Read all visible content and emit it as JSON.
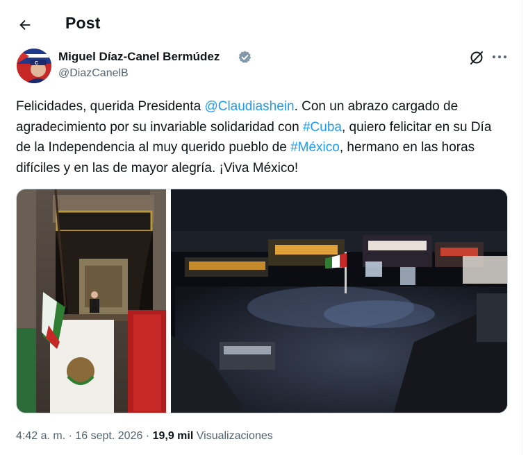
{
  "header": {
    "title": "Post"
  },
  "author": {
    "name": "Miguel Díaz-Canel Bermúdez",
    "handle": "@DiazCanelB",
    "verified": true
  },
  "post": {
    "segments": [
      {
        "text": "Felicidades, querida Presidenta ",
        "type": "text"
      },
      {
        "text": "@Claudiashein",
        "type": "mention"
      },
      {
        "text": ". Con un abrazo cargado de agradecimiento por su invariable solidaridad con ",
        "type": "text"
      },
      {
        "text": "#Cuba",
        "type": "hashtag"
      },
      {
        "text": ", quiero felicitar en su Día de la Independencia al muy querido pueblo de ",
        "type": "text"
      },
      {
        "text": "#México",
        "type": "hashtag"
      },
      {
        "text": ", hermano en las horas difíciles y en las de mayor alegría. ¡Viva México!",
        "type": "text"
      }
    ],
    "media": [
      {
        "icon": "balcony-flag-photo"
      },
      {
        "icon": "zocalo-crowd-photo"
      }
    ]
  },
  "meta": {
    "time": "4:42 a. m.",
    "sep": "·",
    "date": "16 sept. 2026",
    "views_count": "19,9 mil",
    "views_label": "Visualizaciones"
  },
  "colors": {
    "accent": "#1d9bf0",
    "text": "#0f1419",
    "secondary": "#536471",
    "border": "#cfd9de"
  }
}
